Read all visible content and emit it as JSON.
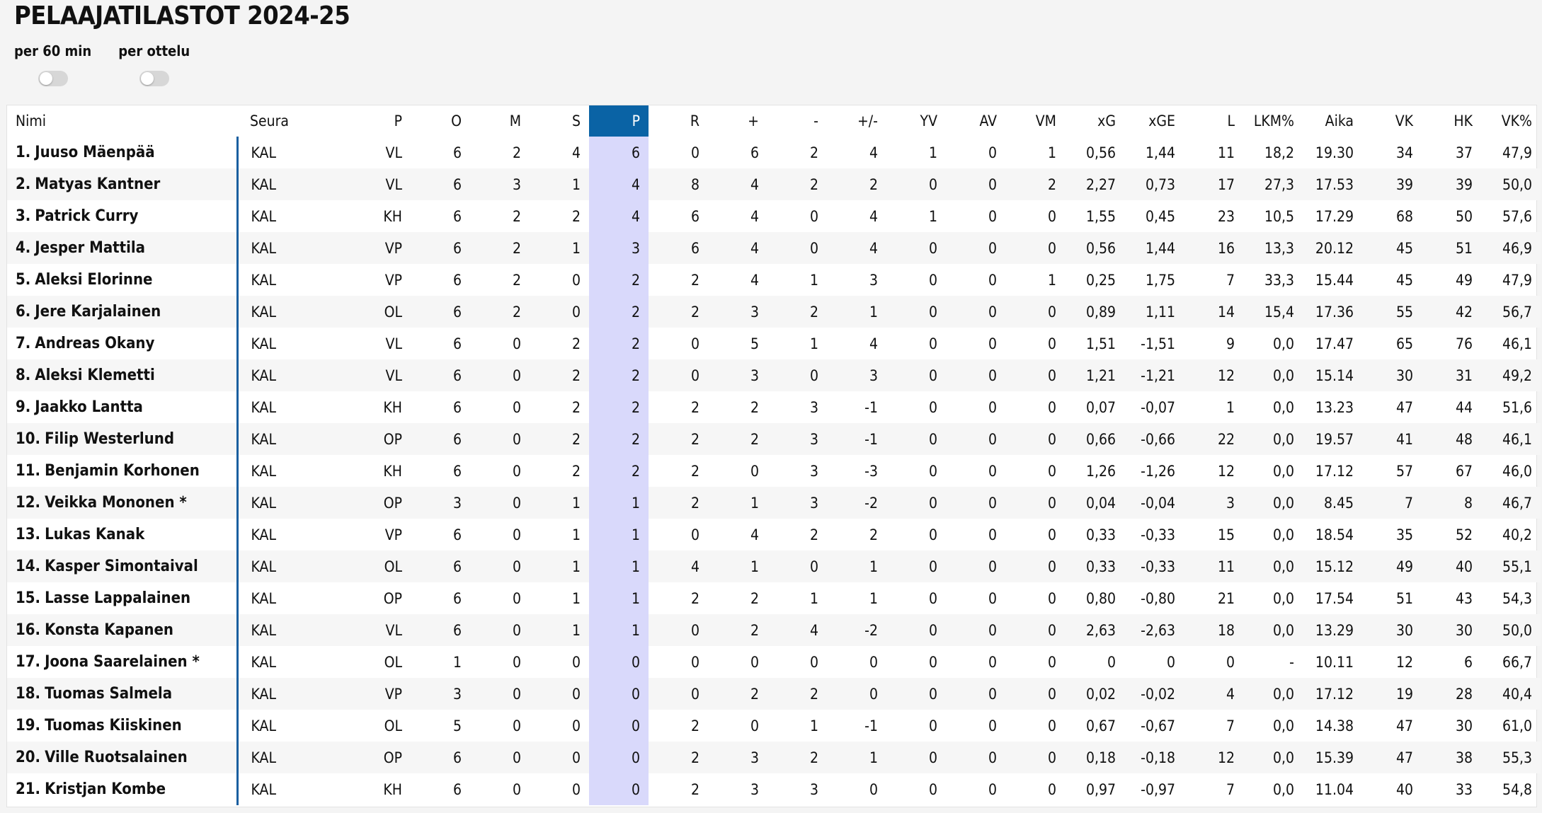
{
  "page": {
    "title": "PELAAJATILASTOT 2024-25"
  },
  "toggles": [
    {
      "label": "per 60 min"
    },
    {
      "label": "per ottelu"
    }
  ],
  "table": {
    "headers": [
      "Nimi",
      "Seura",
      "P",
      "O",
      "M",
      "S",
      "P",
      "R",
      "+",
      "-",
      "+/-",
      "YV",
      "AV",
      "VM",
      "xG",
      "xGE",
      "L",
      "LKM%",
      "Aika",
      "VK",
      "HK",
      "VK%"
    ],
    "sorted_column": 6,
    "rows": [
      [
        "1.",
        "Juuso Mäenpää",
        "KAL",
        "VL",
        "6",
        "2",
        "4",
        "6",
        "0",
        "6",
        "2",
        "4",
        "1",
        "0",
        "1",
        "0,56",
        "1,44",
        "11",
        "18,2",
        "19.30",
        "34",
        "37",
        "47,9"
      ],
      [
        "2.",
        "Matyas Kantner",
        "KAL",
        "VL",
        "6",
        "3",
        "1",
        "4",
        "8",
        "4",
        "2",
        "2",
        "0",
        "0",
        "2",
        "2,27",
        "0,73",
        "17",
        "27,3",
        "17.53",
        "39",
        "39",
        "50,0"
      ],
      [
        "3.",
        "Patrick Curry",
        "KAL",
        "KH",
        "6",
        "2",
        "2",
        "4",
        "6",
        "4",
        "0",
        "4",
        "1",
        "0",
        "0",
        "1,55",
        "0,45",
        "23",
        "10,5",
        "17.29",
        "68",
        "50",
        "57,6"
      ],
      [
        "4.",
        "Jesper Mattila",
        "KAL",
        "VP",
        "6",
        "2",
        "1",
        "3",
        "6",
        "4",
        "0",
        "4",
        "0",
        "0",
        "0",
        "0,56",
        "1,44",
        "16",
        "13,3",
        "20.12",
        "45",
        "51",
        "46,9"
      ],
      [
        "5.",
        "Aleksi Elorinne",
        "KAL",
        "VP",
        "6",
        "2",
        "0",
        "2",
        "2",
        "4",
        "1",
        "3",
        "0",
        "0",
        "1",
        "0,25",
        "1,75",
        "7",
        "33,3",
        "15.44",
        "45",
        "49",
        "47,9"
      ],
      [
        "6.",
        "Jere Karjalainen",
        "KAL",
        "OL",
        "6",
        "2",
        "0",
        "2",
        "2",
        "3",
        "2",
        "1",
        "0",
        "0",
        "0",
        "0,89",
        "1,11",
        "14",
        "15,4",
        "17.36",
        "55",
        "42",
        "56,7"
      ],
      [
        "7.",
        "Andreas Okany",
        "KAL",
        "VL",
        "6",
        "0",
        "2",
        "2",
        "0",
        "5",
        "1",
        "4",
        "0",
        "0",
        "0",
        "1,51",
        "-1,51",
        "9",
        "0,0",
        "17.47",
        "65",
        "76",
        "46,1"
      ],
      [
        "8.",
        "Aleksi Klemetti",
        "KAL",
        "VL",
        "6",
        "0",
        "2",
        "2",
        "0",
        "3",
        "0",
        "3",
        "0",
        "0",
        "0",
        "1,21",
        "-1,21",
        "12",
        "0,0",
        "15.14",
        "30",
        "31",
        "49,2"
      ],
      [
        "9.",
        "Jaakko Lantta",
        "KAL",
        "KH",
        "6",
        "0",
        "2",
        "2",
        "2",
        "2",
        "3",
        "-1",
        "0",
        "0",
        "0",
        "0,07",
        "-0,07",
        "1",
        "0,0",
        "13.23",
        "47",
        "44",
        "51,6"
      ],
      [
        "10.",
        "Filip Westerlund",
        "KAL",
        "OP",
        "6",
        "0",
        "2",
        "2",
        "2",
        "2",
        "3",
        "-1",
        "0",
        "0",
        "0",
        "0,66",
        "-0,66",
        "22",
        "0,0",
        "19.57",
        "41",
        "48",
        "46,1"
      ],
      [
        "11.",
        "Benjamin Korhonen",
        "KAL",
        "KH",
        "6",
        "0",
        "2",
        "2",
        "2",
        "0",
        "3",
        "-3",
        "0",
        "0",
        "0",
        "1,26",
        "-1,26",
        "12",
        "0,0",
        "17.12",
        "57",
        "67",
        "46,0"
      ],
      [
        "12.",
        "Veikka Mononen *",
        "KAL",
        "OP",
        "3",
        "0",
        "1",
        "1",
        "2",
        "1",
        "3",
        "-2",
        "0",
        "0",
        "0",
        "0,04",
        "-0,04",
        "3",
        "0,0",
        "8.45",
        "7",
        "8",
        "46,7"
      ],
      [
        "13.",
        "Lukas Kanak",
        "KAL",
        "VP",
        "6",
        "0",
        "1",
        "1",
        "0",
        "4",
        "2",
        "2",
        "0",
        "0",
        "0",
        "0,33",
        "-0,33",
        "15",
        "0,0",
        "18.54",
        "35",
        "52",
        "40,2"
      ],
      [
        "14.",
        "Kasper Simontaival",
        "KAL",
        "OL",
        "6",
        "0",
        "1",
        "1",
        "4",
        "1",
        "0",
        "1",
        "0",
        "0",
        "0",
        "0,33",
        "-0,33",
        "11",
        "0,0",
        "15.12",
        "49",
        "40",
        "55,1"
      ],
      [
        "15.",
        "Lasse Lappalainen",
        "KAL",
        "OP",
        "6",
        "0",
        "1",
        "1",
        "2",
        "2",
        "1",
        "1",
        "0",
        "0",
        "0",
        "0,80",
        "-0,80",
        "21",
        "0,0",
        "17.54",
        "51",
        "43",
        "54,3"
      ],
      [
        "16.",
        "Konsta Kapanen",
        "KAL",
        "VL",
        "6",
        "0",
        "1",
        "1",
        "0",
        "2",
        "4",
        "-2",
        "0",
        "0",
        "0",
        "2,63",
        "-2,63",
        "18",
        "0,0",
        "13.29",
        "30",
        "30",
        "50,0"
      ],
      [
        "17.",
        "Joona Saarelainen *",
        "KAL",
        "OL",
        "1",
        "0",
        "0",
        "0",
        "0",
        "0",
        "0",
        "0",
        "0",
        "0",
        "0",
        "0",
        "0",
        "0",
        "-",
        "10.11",
        "12",
        "6",
        "66,7"
      ],
      [
        "18.",
        "Tuomas Salmela",
        "KAL",
        "VP",
        "3",
        "0",
        "0",
        "0",
        "0",
        "2",
        "2",
        "0",
        "0",
        "0",
        "0",
        "0,02",
        "-0,02",
        "4",
        "0,0",
        "17.12",
        "19",
        "28",
        "40,4"
      ],
      [
        "19.",
        "Tuomas Kiiskinen",
        "KAL",
        "OL",
        "5",
        "0",
        "0",
        "0",
        "2",
        "0",
        "1",
        "-1",
        "0",
        "0",
        "0",
        "0,67",
        "-0,67",
        "7",
        "0,0",
        "14.38",
        "47",
        "30",
        "61,0"
      ],
      [
        "20.",
        "Ville Ruotsalainen",
        "KAL",
        "OP",
        "6",
        "0",
        "0",
        "0",
        "2",
        "3",
        "2",
        "1",
        "0",
        "0",
        "0",
        "0,18",
        "-0,18",
        "12",
        "0,0",
        "15.39",
        "47",
        "38",
        "55,3"
      ],
      [
        "21.",
        "Kristjan Kombe",
        "KAL",
        "KH",
        "6",
        "0",
        "0",
        "0",
        "2",
        "3",
        "3",
        "0",
        "0",
        "0",
        "0",
        "0,97",
        "-0,97",
        "7",
        "0,0",
        "11.04",
        "40",
        "33",
        "54,8"
      ]
    ]
  }
}
